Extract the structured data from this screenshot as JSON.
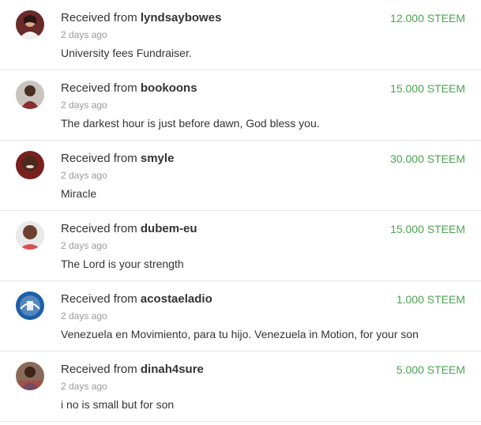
{
  "colors": {
    "amount": "#4ba351",
    "timestamp": "#9a9a9a",
    "text": "#333333",
    "divider": "#e6e6e6"
  },
  "transactions": [
    {
      "prefix": "Received from",
      "user": "lyndsaybowes",
      "time": "2 days ago",
      "memo": "University fees Fundraiser.",
      "amount": "12.000 STEEM",
      "avatar_icon": "user-avatar-icon"
    },
    {
      "prefix": "Received from",
      "user": "bookoons",
      "time": "2 days ago",
      "memo": "The darkest hour is just before dawn, God bless you.",
      "amount": "15.000 STEEM",
      "avatar_icon": "user-avatar-icon"
    },
    {
      "prefix": "Received from",
      "user": "smyle",
      "time": "2 days ago",
      "memo": "Miracle",
      "amount": "30.000 STEEM",
      "avatar_icon": "user-avatar-icon"
    },
    {
      "prefix": "Received from",
      "user": "dubem-eu",
      "time": "2 days ago",
      "memo": "The Lord is your strength",
      "amount": "15.000 STEEM",
      "avatar_icon": "user-avatar-icon"
    },
    {
      "prefix": "Received from",
      "user": "acostaeladio",
      "time": "2 days ago",
      "memo": "Venezuela en Movimiento, para tu hijo. Venezuela in Motion, for your son",
      "amount": "1.000 STEEM",
      "avatar_icon": "logo-avatar-icon"
    },
    {
      "prefix": "Received from",
      "user": "dinah4sure",
      "time": "2 days ago",
      "memo": "i no is small but for son",
      "amount": "5.000 STEEM",
      "avatar_icon": "user-avatar-icon"
    }
  ]
}
